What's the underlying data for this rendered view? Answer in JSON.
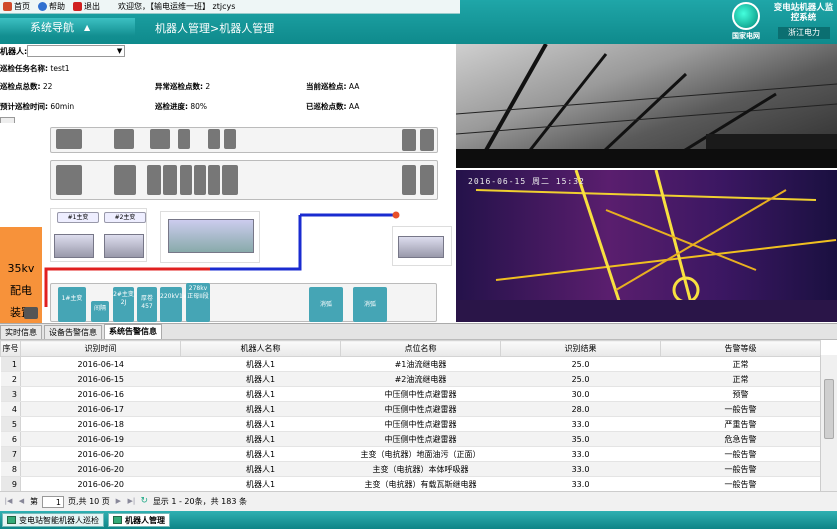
{
  "top_links": [
    {
      "label": "首页",
      "icon": "home-icon",
      "color": "#d04a2a"
    },
    {
      "label": "帮助",
      "icon": "help-icon",
      "color": "#3070d0"
    },
    {
      "label": "退出",
      "icon": "logout-icon",
      "color": "#d02020"
    }
  ],
  "welcome": "欢迎您，【输电运维一班】 ztjcys",
  "nav_title": "系统导航",
  "breadcrumb": "机器人管理>机器人管理",
  "brand": "国家电网",
  "system_title": "变电站机器人监控系统",
  "org": "浙江电力",
  "robot": {
    "label": "机器人:",
    "value": ""
  },
  "task_info": {
    "task_name_label": "巡检任务名称:",
    "task_name": "test1",
    "total_label": "巡检点总数:",
    "total": "22",
    "abnormal_label": "异常巡检点数:",
    "abnormal": "2",
    "current_label": "当前巡检点:",
    "current": "AA",
    "est_time_label": "预计巡检时间:",
    "est_time": "60min",
    "progress_label": "巡检进度:",
    "progress": "80%",
    "done_label": "已巡检点数:",
    "done": "AA"
  },
  "diagram": {
    "area_label_line1": "35kv",
    "area_label_line2": "配电",
    "area_label_line3": "装置",
    "transformer_1": "#1主变",
    "transformer_2": "#2主变",
    "bottom_cells": [
      "1#主变",
      "间隔",
      "2#主变2J",
      "厚卷457",
      "220kV1#",
      "278kv正母II段",
      "消弧",
      "消弧"
    ]
  },
  "camera": {
    "timestamp": "2016-06-15 周二 15:32"
  },
  "tabs": [
    {
      "label": "实时信息",
      "active": false
    },
    {
      "label": "设备告警信息",
      "active": false
    },
    {
      "label": "系统告警信息",
      "active": true
    }
  ],
  "table": {
    "columns": [
      "序号",
      "识别时间",
      "机器人名称",
      "点位名称",
      "识别结果",
      "告警等级"
    ],
    "rows": [
      [
        "1",
        "2016-06-14",
        "机器人1",
        "#1油流继电器",
        "25.0",
        "正常"
      ],
      [
        "2",
        "2016-06-15",
        "机器人1",
        "#2油流继电器",
        "25.0",
        "正常"
      ],
      [
        "3",
        "2016-06-16",
        "机器人1",
        "中压侧中性点避雷器",
        "30.0",
        "预警"
      ],
      [
        "4",
        "2016-06-17",
        "机器人1",
        "中压侧中性点避雷器",
        "28.0",
        "一般告警"
      ],
      [
        "5",
        "2016-06-18",
        "机器人1",
        "中压侧中性点避雷器",
        "33.0",
        "严重告警"
      ],
      [
        "6",
        "2016-06-19",
        "机器人1",
        "中压侧中性点避雷器",
        "35.0",
        "危急告警"
      ],
      [
        "7",
        "2016-06-20",
        "机器人1",
        "主变（电抗器）地面油污（正面）",
        "33.0",
        "一般告警"
      ],
      [
        "8",
        "2016-06-20",
        "机器人1",
        "主变（电抗器）本体呼吸器",
        "33.0",
        "一般告警"
      ],
      [
        "9",
        "2016-06-20",
        "机器人1",
        "主变（电抗器）有载瓦斯继电器",
        "33.0",
        "一般告警"
      ]
    ]
  },
  "pager": {
    "page_prefix": "第",
    "page": "1",
    "page_suffix": "页,共 10 页",
    "summary": "显示 1 - 20条，共 183 条"
  },
  "taskbar": [
    {
      "label": "变电站智能机器人巡检",
      "active": false
    },
    {
      "label": "机器人管理",
      "active": true
    }
  ]
}
